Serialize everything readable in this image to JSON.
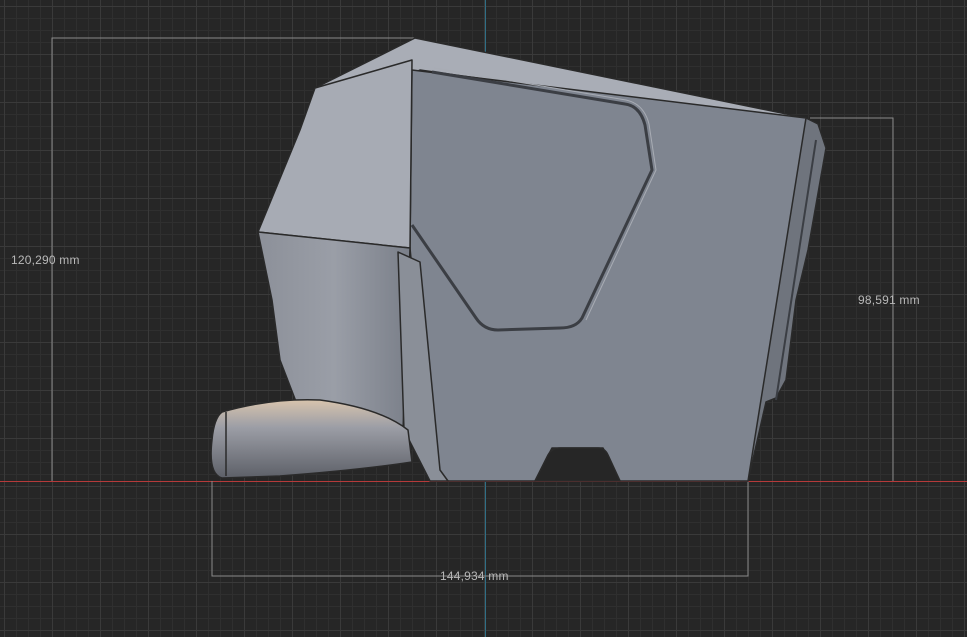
{
  "dimensions": {
    "height_total": "120,290 mm",
    "height_body": "98,591 mm",
    "width": "144,934 mm"
  },
  "colors": {
    "background": "#262626",
    "grid_major": "#3a3a3a",
    "axis_x": "#b53a3a",
    "axis_y": "#2f6f86",
    "model_body": "#7f8590",
    "dimension_line": "#8a8a8a"
  }
}
